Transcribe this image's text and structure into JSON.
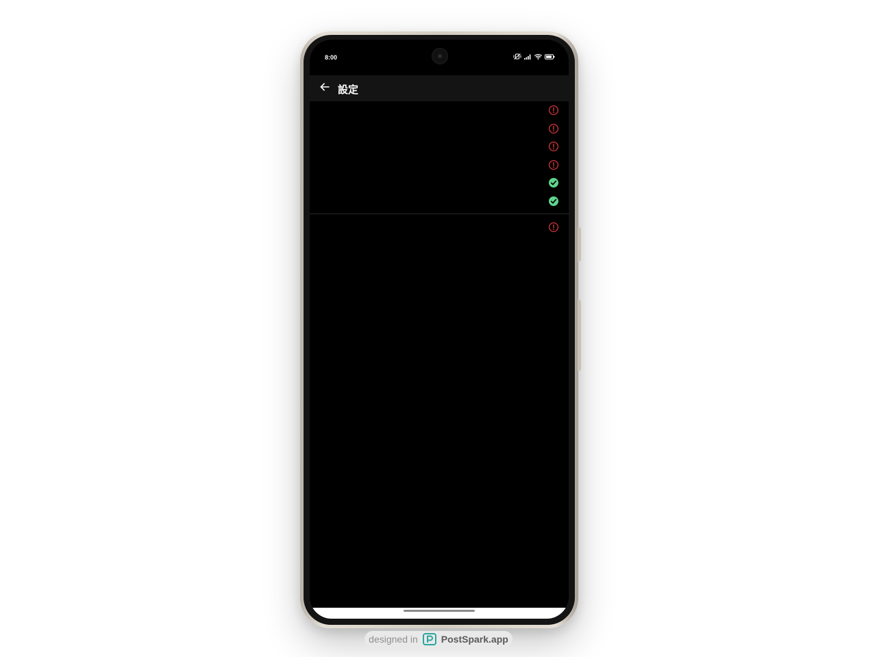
{
  "status_bar": {
    "time": "8:00",
    "icons": [
      "vibrate-off-icon",
      "signal-icon",
      "wifi-icon",
      "battery-icon"
    ]
  },
  "app_bar": {
    "back_icon": "arrow-left-icon",
    "title": "設定"
  },
  "settings_status": {
    "group1": [
      {
        "state": "error",
        "icon": "alert-circle-icon",
        "color": "#d3373a"
      },
      {
        "state": "error",
        "icon": "alert-circle-icon",
        "color": "#d3373a"
      },
      {
        "state": "error",
        "icon": "alert-circle-icon",
        "color": "#d3373a"
      },
      {
        "state": "error",
        "icon": "alert-circle-icon",
        "color": "#d3373a"
      },
      {
        "state": "ok",
        "icon": "check-circle-icon",
        "color": "#5fd38d"
      },
      {
        "state": "ok",
        "icon": "check-circle-icon",
        "color": "#5fd38d"
      }
    ],
    "group2": [
      {
        "state": "error",
        "icon": "alert-circle-icon",
        "color": "#d3373a"
      }
    ]
  },
  "watermark": {
    "prefix": "designed in",
    "brand": "PostSpark.app",
    "logo_color": "#2aa6a0"
  }
}
